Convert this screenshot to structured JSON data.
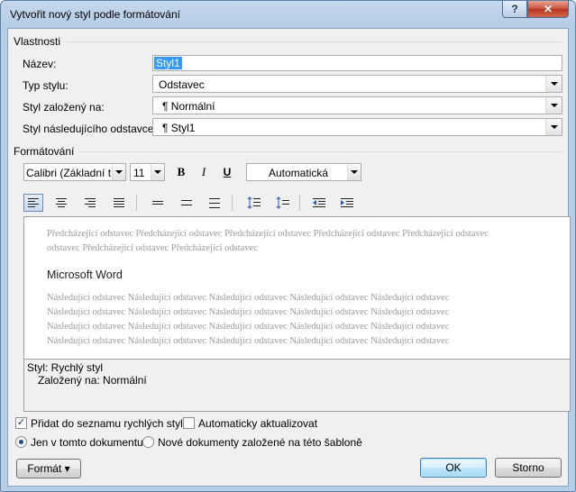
{
  "window": {
    "title": "Vytvořit nový styl podle formátování"
  },
  "titlebar": {
    "help_label": "?",
    "close_label": "✕"
  },
  "properties": {
    "section_label": "Vlastnosti",
    "name_label": "Název:",
    "name_value": "Styl1",
    "style_type_label": "Typ stylu:",
    "style_type_value": "Odstavec",
    "based_on_label": "Styl založený na:",
    "based_on_value": "¶ Normální",
    "next_style_label": "Styl následujícího odstavce:",
    "next_style_value": "¶ Styl1"
  },
  "formatting": {
    "section_label": "Formátování",
    "font_value": "Calibri (Základní tex",
    "size_value": "11",
    "bold_label": "B",
    "italic_label": "I",
    "underline_label": "U",
    "color_value": "Automatická"
  },
  "preview": {
    "previous_lines": [
      "Předcházející odstavec Předcházející odstavec Předcházející odstavec Předcházející odstavec Předcházející odstavec",
      "odstavec Předcházející odstavec Předcházející odstavec"
    ],
    "sample_text": "Microsoft Word",
    "following_lines": [
      "Následující odstavec Následující odstavec Následující odstavec Následující odstavec Následující odstavec",
      "Následující odstavec Následující odstavec Následující odstavec Následující odstavec Následující odstavec",
      "Následující odstavec Následující odstavec Následující odstavec Následující odstavec Následující odstavec",
      "Následující odstavec Následující odstavec Následující odstavec Následující odstavec Následující odstavec"
    ]
  },
  "description": {
    "line1": "Styl: Rychlý styl",
    "line2": "Založený na: Normální"
  },
  "options": {
    "add_quick_label": "Přidat do seznamu rychlých stylů",
    "add_quick_checked": true,
    "auto_update_label": "Automaticky aktualizovat",
    "auto_update_checked": false,
    "only_document_label": "Jen v tomto dokumentu",
    "new_documents_label": "Nové dokumenty založené na této šabloně"
  },
  "buttons": {
    "format_label": "Formát ▾",
    "ok_label": "OK",
    "cancel_label": "Storno"
  },
  "colors": {
    "selection": "#3399ff",
    "title_gradient": "#b6cde6",
    "close_button": "#c7503a"
  }
}
